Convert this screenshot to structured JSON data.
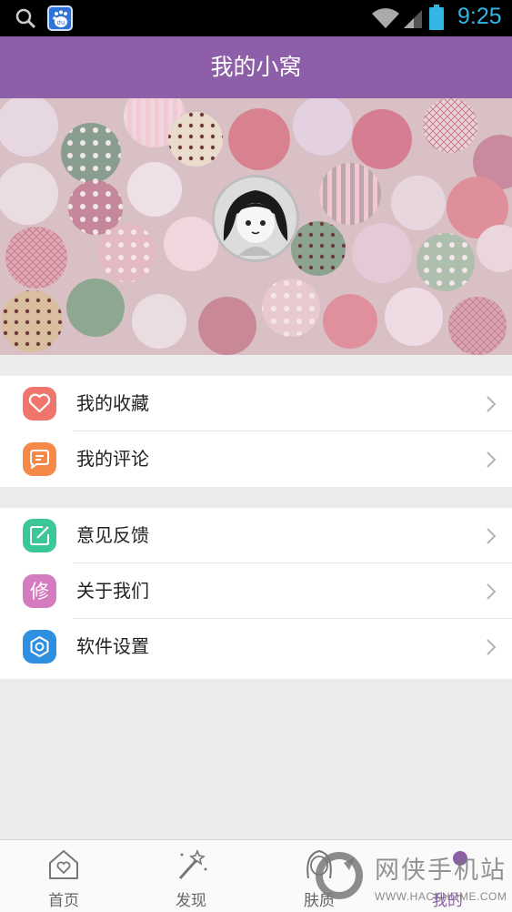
{
  "status_bar": {
    "time": "9:25",
    "icons": [
      "search-icon",
      "baidu-icon",
      "wifi-icon",
      "signal-icon",
      "battery-icon"
    ],
    "time_color": "#33b5e5"
  },
  "header": {
    "title": "我的小窝",
    "background": "#8d5fa8"
  },
  "menu": {
    "group1": [
      {
        "label": "我的收藏",
        "icon": "heart-icon",
        "color": "#f0756c"
      },
      {
        "label": "我的评论",
        "icon": "comment-icon",
        "color": "#f5894a"
      }
    ],
    "group2": [
      {
        "label": "意见反馈",
        "icon": "feedback-edit-icon",
        "color": "#3cc79a"
      },
      {
        "label": "关于我们",
        "icon": "about-icon",
        "color": "#d47cbf",
        "glyph": "修"
      },
      {
        "label": "软件设置",
        "icon": "settings-gear-icon",
        "color": "#2e8fe0"
      }
    ]
  },
  "bottom_nav": [
    {
      "label": "首页",
      "icon": "home-heart-icon",
      "active": false
    },
    {
      "label": "发现",
      "icon": "magic-wand-icon",
      "active": false
    },
    {
      "label": "肤质",
      "icon": "face-icon",
      "active": false
    },
    {
      "label": "我的",
      "icon": "profile-icon",
      "active": true
    }
  ],
  "watermark": {
    "text": "网侠手机站",
    "url": "WWW.HACKHOME.COM"
  }
}
